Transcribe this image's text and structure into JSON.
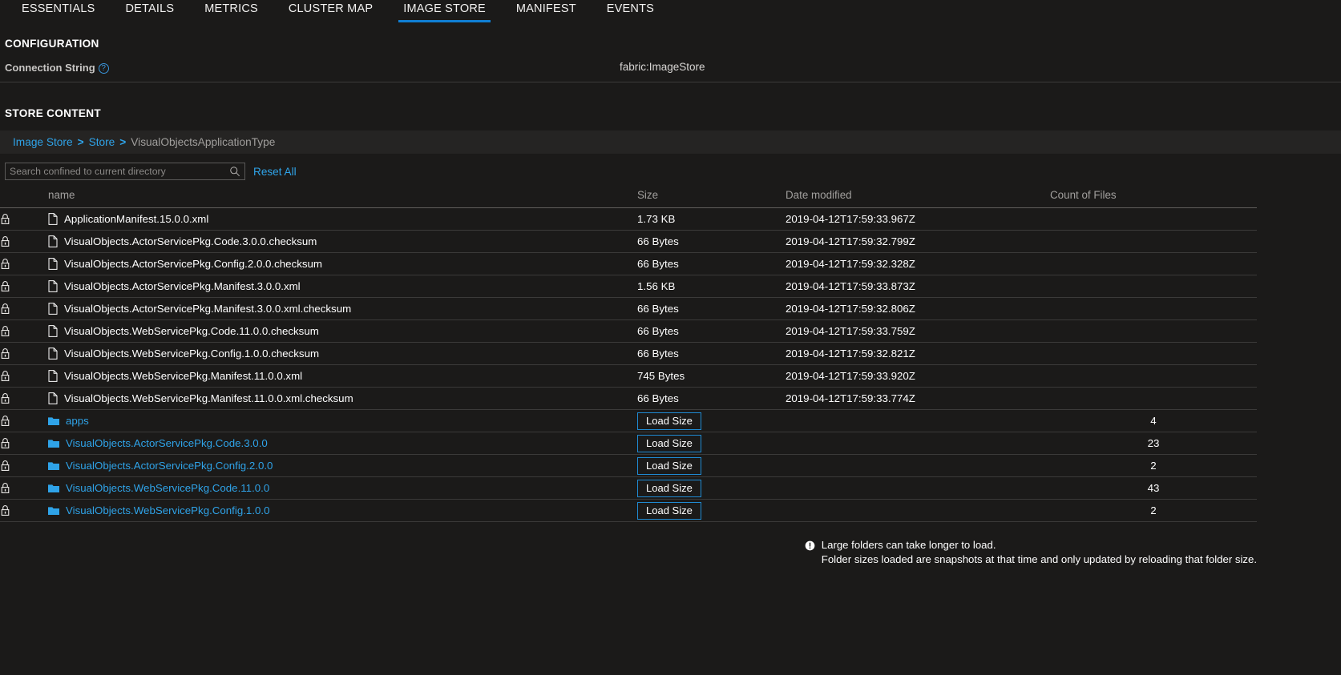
{
  "tabs": [
    {
      "label": "ESSENTIALS",
      "active": false
    },
    {
      "label": "DETAILS",
      "active": false
    },
    {
      "label": "METRICS",
      "active": false
    },
    {
      "label": "CLUSTER MAP",
      "active": false
    },
    {
      "label": "IMAGE STORE",
      "active": true
    },
    {
      "label": "MANIFEST",
      "active": false
    },
    {
      "label": "EVENTS",
      "active": false
    }
  ],
  "configuration": {
    "heading": "CONFIGURATION",
    "connection_string_label": "Connection String",
    "connection_string_value": "fabric:ImageStore",
    "help_glyph": "?"
  },
  "store_content": {
    "heading": "STORE CONTENT",
    "breadcrumb": {
      "items": [
        {
          "label": "Image Store",
          "link": true
        },
        {
          "label": "Store",
          "link": true
        },
        {
          "label": "VisualObjectsApplicationType",
          "link": false
        }
      ],
      "separator": ">"
    },
    "search": {
      "placeholder": "Search confined to current directory",
      "value": "",
      "reset_label": "Reset All"
    },
    "table": {
      "columns": [
        "name",
        "Size",
        "Date modified",
        "Count of Files"
      ],
      "load_size_label": "Load Size",
      "rows": [
        {
          "type": "file",
          "name": "ApplicationManifest.15.0.0.xml",
          "size": "1.73 KB",
          "date": "2019-04-12T17:59:33.967Z",
          "count": ""
        },
        {
          "type": "file",
          "name": "VisualObjects.ActorServicePkg.Code.3.0.0.checksum",
          "size": "66 Bytes",
          "date": "2019-04-12T17:59:32.799Z",
          "count": ""
        },
        {
          "type": "file",
          "name": "VisualObjects.ActorServicePkg.Config.2.0.0.checksum",
          "size": "66 Bytes",
          "date": "2019-04-12T17:59:32.328Z",
          "count": ""
        },
        {
          "type": "file",
          "name": "VisualObjects.ActorServicePkg.Manifest.3.0.0.xml",
          "size": "1.56 KB",
          "date": "2019-04-12T17:59:33.873Z",
          "count": ""
        },
        {
          "type": "file",
          "name": "VisualObjects.ActorServicePkg.Manifest.3.0.0.xml.checksum",
          "size": "66 Bytes",
          "date": "2019-04-12T17:59:32.806Z",
          "count": ""
        },
        {
          "type": "file",
          "name": "VisualObjects.WebServicePkg.Code.11.0.0.checksum",
          "size": "66 Bytes",
          "date": "2019-04-12T17:59:33.759Z",
          "count": ""
        },
        {
          "type": "file",
          "name": "VisualObjects.WebServicePkg.Config.1.0.0.checksum",
          "size": "66 Bytes",
          "date": "2019-04-12T17:59:32.821Z",
          "count": ""
        },
        {
          "type": "file",
          "name": "VisualObjects.WebServicePkg.Manifest.11.0.0.xml",
          "size": "745 Bytes",
          "date": "2019-04-12T17:59:33.920Z",
          "count": ""
        },
        {
          "type": "file",
          "name": "VisualObjects.WebServicePkg.Manifest.11.0.0.xml.checksum",
          "size": "66 Bytes",
          "date": "2019-04-12T17:59:33.774Z",
          "count": ""
        },
        {
          "type": "folder",
          "name": "apps",
          "size": "",
          "date": "",
          "count": "4"
        },
        {
          "type": "folder",
          "name": "VisualObjects.ActorServicePkg.Code.3.0.0",
          "size": "",
          "date": "",
          "count": "23"
        },
        {
          "type": "folder",
          "name": "VisualObjects.ActorServicePkg.Config.2.0.0",
          "size": "",
          "date": "",
          "count": "2"
        },
        {
          "type": "folder",
          "name": "VisualObjects.WebServicePkg.Code.11.0.0",
          "size": "",
          "date": "",
          "count": "43"
        },
        {
          "type": "folder",
          "name": "VisualObjects.WebServicePkg.Config.1.0.0",
          "size": "",
          "date": "",
          "count": "2"
        }
      ]
    },
    "footer_notes": [
      "Large folders can take longer to load.",
      "Folder sizes loaded are snapshots at that time and only updated by reloading that folder size."
    ]
  },
  "colors": {
    "background": "#1b1a19",
    "accent_blue": "#0f7fd4",
    "link_blue": "#2fa3e8",
    "muted_text": "#a19f9d",
    "row_divider": "#3b3a39"
  }
}
